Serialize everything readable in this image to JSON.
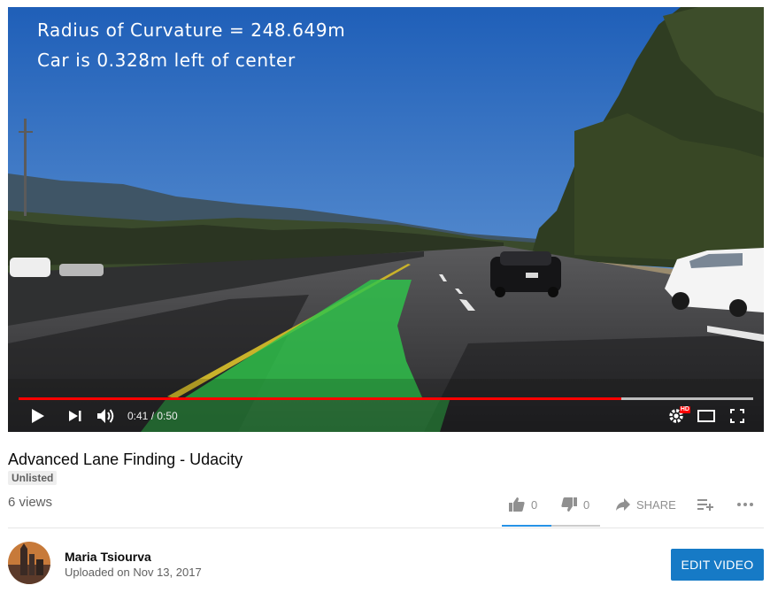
{
  "player": {
    "overlay_line1": "Radius of Curvature = 248.649m",
    "overlay_line2": "Car is 0.328m left of center",
    "current_time": "0:41",
    "duration": "0:50",
    "time_display": "0:41 / 0:50",
    "progress_fraction": 0.82,
    "hd_badge": "HD",
    "icons": {
      "play": "play-icon",
      "next": "next-icon",
      "volume": "volume-icon",
      "settings": "settings-icon",
      "theater": "theater-mode-icon",
      "fullscreen": "fullscreen-icon"
    },
    "colors": {
      "progress": "#ff0000",
      "lane_overlay": "#2ec54a"
    }
  },
  "video": {
    "title": "Advanced Lane Finding - Udacity",
    "badge": "Unlisted",
    "views": "6 views"
  },
  "actions": {
    "like_count": "0",
    "dislike_count": "0",
    "share_label": "SHARE",
    "sentiment_like_fraction": 0.5,
    "colors": {
      "sentiment": "#2793e6"
    }
  },
  "channel": {
    "name": "Maria Tsiourva",
    "uploaded": "Uploaded on Nov 13, 2017",
    "edit_button": "EDIT VIDEO",
    "colors": {
      "edit_button": "#167ac6"
    }
  }
}
